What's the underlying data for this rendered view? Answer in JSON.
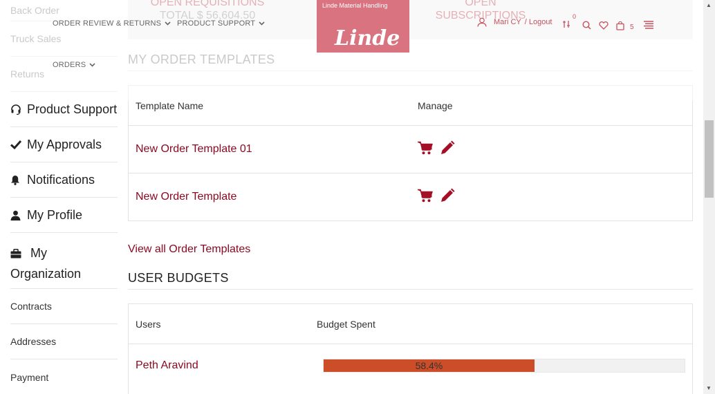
{
  "sidebar": {
    "items": [
      {
        "label": "Back Order"
      },
      {
        "label": "Truck Sales"
      },
      {
        "label": "Returns"
      },
      {
        "label": "Product Support",
        "icon": "headset-icon"
      },
      {
        "label": "My Approvals",
        "icon": "check-icon"
      },
      {
        "label": "Notifications",
        "icon": "bell-icon"
      },
      {
        "label": "My Profile",
        "icon": "user-icon"
      },
      {
        "label": "My Organization",
        "icon": "briefcase-icon"
      },
      {
        "label": "Contracts"
      },
      {
        "label": "Addresses"
      },
      {
        "label": "Payment"
      }
    ]
  },
  "header": {
    "nav": {
      "order_review": "ORDER REVIEW & RETURNS",
      "product_support": "PRODUCT SUPPORT",
      "orders": "ORDERS"
    },
    "logo": {
      "subtitle": "Linde Material Handling",
      "wordmark": "Linde"
    },
    "user": {
      "name": "Mari CY",
      "logout": "/ Logout"
    },
    "compare_count": "0",
    "cart_count": "5"
  },
  "stats": {
    "requisitions": {
      "title": "OPEN REQUISITIONS",
      "total": "TOTAL $ 56,604.50"
    },
    "subscriptions": {
      "title": "OPEN",
      "subtitle": "SUBSCRIPTIONS"
    }
  },
  "templates": {
    "title": "MY ORDER TEMPLATES",
    "headers": {
      "name": "Template Name",
      "manage": "Manage"
    },
    "rows": [
      {
        "name": "New Order Template 01"
      },
      {
        "name": "New Order Template"
      }
    ],
    "view_all": "View all Order Templates"
  },
  "budgets": {
    "title": "USER BUDGETS",
    "headers": {
      "users": "Users",
      "spent": "Budget Spent"
    },
    "rows": [
      {
        "user": "Peth Aravind",
        "spent_percent": 58.4,
        "spent_label": "58.4%"
      }
    ]
  },
  "colors": {
    "accent": "#8b0a22",
    "brand": "#c6505c",
    "bar": "#cb4e28"
  }
}
